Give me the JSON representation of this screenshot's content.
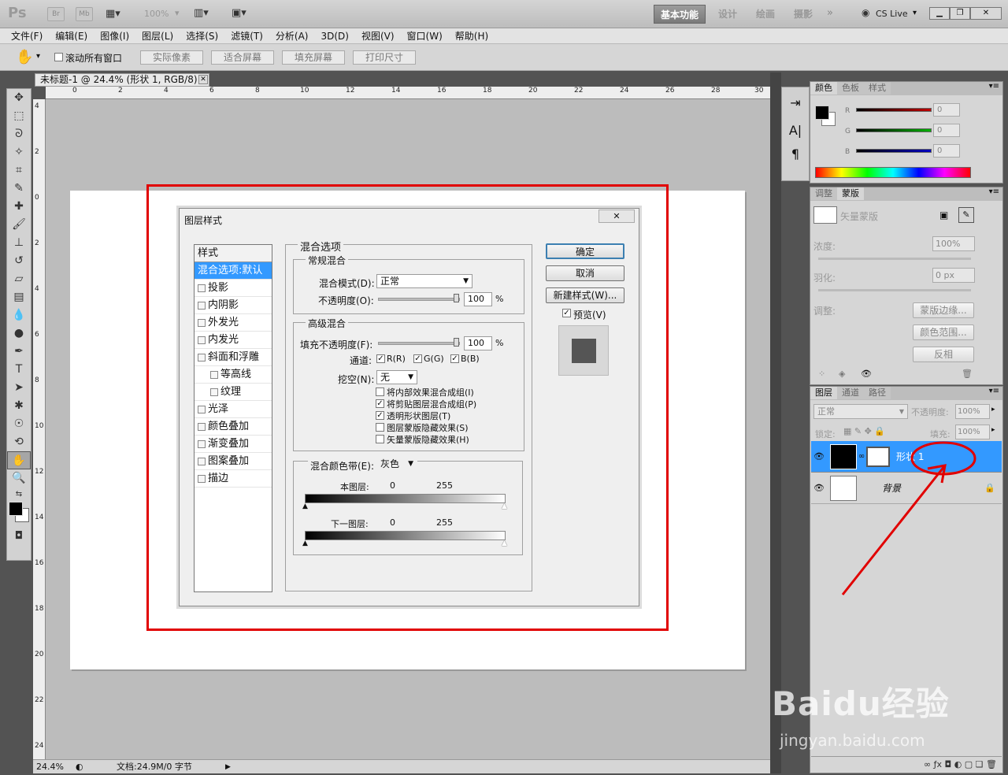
{
  "app": {
    "logo": "Ps",
    "bridge": "Br",
    "minibridge": "Mb",
    "zoom": "100%",
    "workspaces": [
      "基本功能",
      "设计",
      "绘画",
      "摄影"
    ],
    "cslive": "CS Live"
  },
  "menu": [
    "文件(F)",
    "编辑(E)",
    "图像(I)",
    "图层(L)",
    "选择(S)",
    "滤镜(T)",
    "分析(A)",
    "3D(D)",
    "视图(V)",
    "窗口(W)",
    "帮助(H)"
  ],
  "options": {
    "scroll_all": "滚动所有窗口",
    "buttons": [
      "实际像素",
      "适合屏幕",
      "填充屏幕",
      "打印尺寸"
    ]
  },
  "document": {
    "tab_title": "未标题-1 @ 24.4% (形状 1, RGB/8) *",
    "h_ruler": [
      "0",
      "2",
      "4",
      "6",
      "8",
      "10",
      "12",
      "14",
      "16",
      "18",
      "20",
      "22",
      "24",
      "26",
      "28",
      "30"
    ],
    "v_ruler": [
      "4",
      "2",
      "0",
      "2",
      "4",
      "6",
      "8",
      "10",
      "12",
      "14",
      "16",
      "18",
      "20",
      "22",
      "24"
    ],
    "status_zoom": "24.4%",
    "status_doc": "文档:24.9M/0 字节"
  },
  "dialog": {
    "title": "图层样式",
    "styles_header": "样式",
    "styles": [
      {
        "label": "混合选项:默认",
        "selected": true,
        "checkbox": false,
        "sub": false
      },
      {
        "label": "投影",
        "checkbox": true,
        "sub": false
      },
      {
        "label": "内阴影",
        "checkbox": true,
        "sub": false
      },
      {
        "label": "外发光",
        "checkbox": true,
        "sub": false
      },
      {
        "label": "内发光",
        "checkbox": true,
        "sub": false
      },
      {
        "label": "斜面和浮雕",
        "checkbox": true,
        "sub": false
      },
      {
        "label": "等高线",
        "checkbox": true,
        "sub": true
      },
      {
        "label": "纹理",
        "checkbox": true,
        "sub": true
      },
      {
        "label": "光泽",
        "checkbox": true,
        "sub": false
      },
      {
        "label": "颜色叠加",
        "checkbox": true,
        "sub": false
      },
      {
        "label": "渐变叠加",
        "checkbox": true,
        "sub": false
      },
      {
        "label": "图案叠加",
        "checkbox": true,
        "sub": false
      },
      {
        "label": "描边",
        "checkbox": true,
        "sub": false
      }
    ],
    "blend_options": "混合选项",
    "general_blend": "常规混合",
    "blend_mode_label": "混合模式(D):",
    "blend_mode_value": "正常",
    "opacity_label": "不透明度(O):",
    "opacity_value": "100",
    "percent": "%",
    "advanced_blend": "高级混合",
    "fill_opacity_label": "填充不透明度(F):",
    "fill_opacity_value": "100",
    "channels_label": "通道:",
    "channel_r": "R(R)",
    "channel_g": "G(G)",
    "channel_b": "B(B)",
    "knockout_label": "挖空(N):",
    "knockout_value": "无",
    "options_checks": [
      {
        "label": "将内部效果混合成组(I)",
        "checked": false
      },
      {
        "label": "将剪贴图层混合成组(P)",
        "checked": true
      },
      {
        "label": "透明形状图层(T)",
        "checked": true
      },
      {
        "label": "图层蒙版隐藏效果(S)",
        "checked": false
      },
      {
        "label": "矢量蒙版隐藏效果(H)",
        "checked": false
      }
    ],
    "blend_if_label": "混合颜色带(E):",
    "blend_if_value": "灰色",
    "this_layer": "本图层:",
    "underlying_layer": "下一图层:",
    "range_min": "0",
    "range_max": "255",
    "ok": "确定",
    "cancel": "取消",
    "new_style": "新建样式(W)...",
    "preview": "预览(V)"
  },
  "color_panel": {
    "tabs": [
      "颜色",
      "色板",
      "样式"
    ],
    "channels": [
      {
        "name": "R",
        "value": "0",
        "color": "#c00000"
      },
      {
        "name": "G",
        "value": "0",
        "color": "#00b000"
      },
      {
        "name": "B",
        "value": "0",
        "color": "#0000c0"
      }
    ]
  },
  "masks_panel": {
    "tabs": [
      "调整",
      "蒙版"
    ],
    "vector_mask": "矢量蒙版",
    "density_label": "浓度:",
    "density_value": "100%",
    "feather_label": "羽化:",
    "feather_value": "0 px",
    "refine_label": "调整:",
    "mask_edge": "蒙版边缘...",
    "color_range": "颜色范围...",
    "invert": "反相"
  },
  "layers_panel": {
    "tabs": [
      "图层",
      "通道",
      "路径"
    ],
    "blend_mode": "正常",
    "opacity_label": "不透明度:",
    "opacity_value": "100%",
    "lock_label": "锁定:",
    "fill_label": "填充:",
    "fill_value": "100%",
    "layers": [
      {
        "name": "形状 1",
        "selected": true
      },
      {
        "name": "背景",
        "selected": false
      }
    ]
  },
  "watermark": {
    "brand": "Baidu经验",
    "url": "jingyan.baidu.com"
  },
  "colors": {
    "annotation_red": "#e10000",
    "selection_blue": "#3399ff"
  }
}
